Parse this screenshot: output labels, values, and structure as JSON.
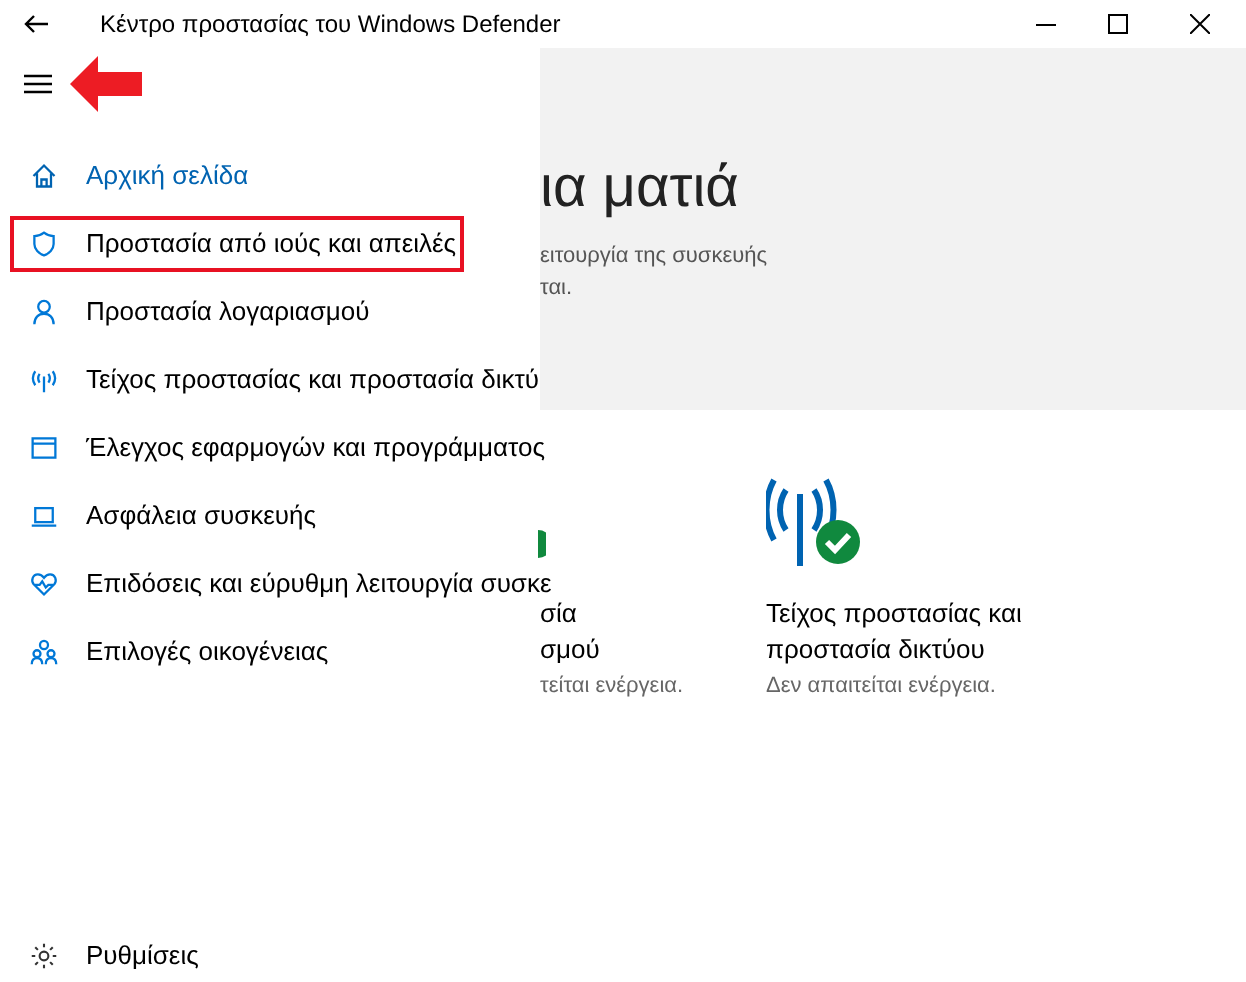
{
  "window": {
    "title": "Κέντρο προστασίας του Windows Defender"
  },
  "sidebar": {
    "items": [
      {
        "kind": "home",
        "label": "Αρχική σελίδα",
        "selected": true,
        "outlined": false
      },
      {
        "kind": "shield",
        "label": "Προστασία από ιούς και απειλές",
        "selected": false,
        "outlined": true
      },
      {
        "kind": "person",
        "label": "Προστασία λογαριασμού",
        "selected": false,
        "outlined": false
      },
      {
        "kind": "antenna",
        "label": "Τείχος προστασίας και προστασία δικτύ",
        "selected": false,
        "outlined": false
      },
      {
        "kind": "window",
        "label": "Έλεγχος εφαρμογών και προγράμματος",
        "selected": false,
        "outlined": false
      },
      {
        "kind": "laptop",
        "label": "Ασφάλεια συσκευής",
        "selected": false,
        "outlined": false
      },
      {
        "kind": "heart",
        "label": "Επιδόσεις και εύρυθμη λειτουργία συσκε",
        "selected": false,
        "outlined": false
      },
      {
        "kind": "family",
        "label": "Επιλογές οικογένειας",
        "selected": false,
        "outlined": false
      }
    ],
    "settings": "Ρυθμίσεις"
  },
  "hero": {
    "title": "ια ματιά",
    "subtitle_lines": [
      "ειτουργία της συσκευής",
      "ται."
    ]
  },
  "cards": [
    {
      "kind": "check",
      "title_lines": [
        "σία",
        "σμού"
      ],
      "status": "τείται ενέργεια."
    },
    {
      "kind": "antenna",
      "title_lines": [
        "Τείχος προστασίας και",
        "προστασία δικτύου"
      ],
      "status": "Δεν απαιτείται ενέργεια."
    }
  ]
}
